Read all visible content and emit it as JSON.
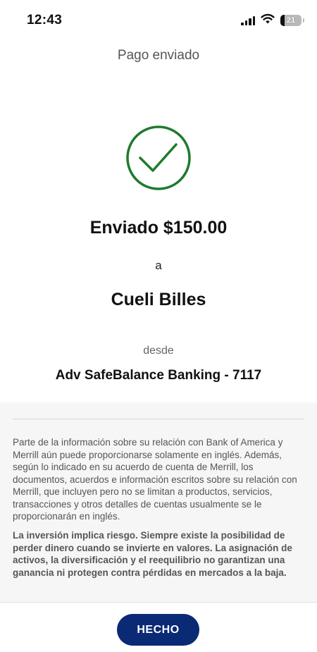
{
  "status_bar": {
    "time": "12:43",
    "battery_level": "21"
  },
  "header": {
    "title": "Pago enviado"
  },
  "confirmation": {
    "sent_amount": "Enviado $150.00",
    "to_label": "a",
    "recipient": "Cueli Billes",
    "from_label": "desde",
    "account": "Adv SafeBalance Banking - 7117",
    "success_color": "#1f7a2e"
  },
  "disclosures": {
    "paragraph_1": "Parte de la información sobre su relación con Bank of America y Merrill aún puede proporcionarse solamente en inglés. Además, según lo indicado en su acuerdo de cuenta de Merrill, los documentos, acuerdos e información escritos sobre su relación con Merrill, que incluyen pero no se limitan a productos, servicios, transacciones y otros detalles de cuentas usualmente se le proporcionarán en inglés.",
    "paragraph_2": "La inversión implica riesgo. Siempre existe la posibilidad de perder dinero cuando se invierte en valores. La asignación de activos, la diversificación y el reequilibrio no garantizan una ganancia ni protegen contra pérdidas en mercados a la baja."
  },
  "footer": {
    "done_label": "HECHO",
    "button_color": "#0a2a75"
  },
  "icons": {
    "success": "check-circle-icon",
    "signal": "cellular-signal-icon",
    "wifi": "wifi-icon",
    "battery": "battery-icon"
  }
}
